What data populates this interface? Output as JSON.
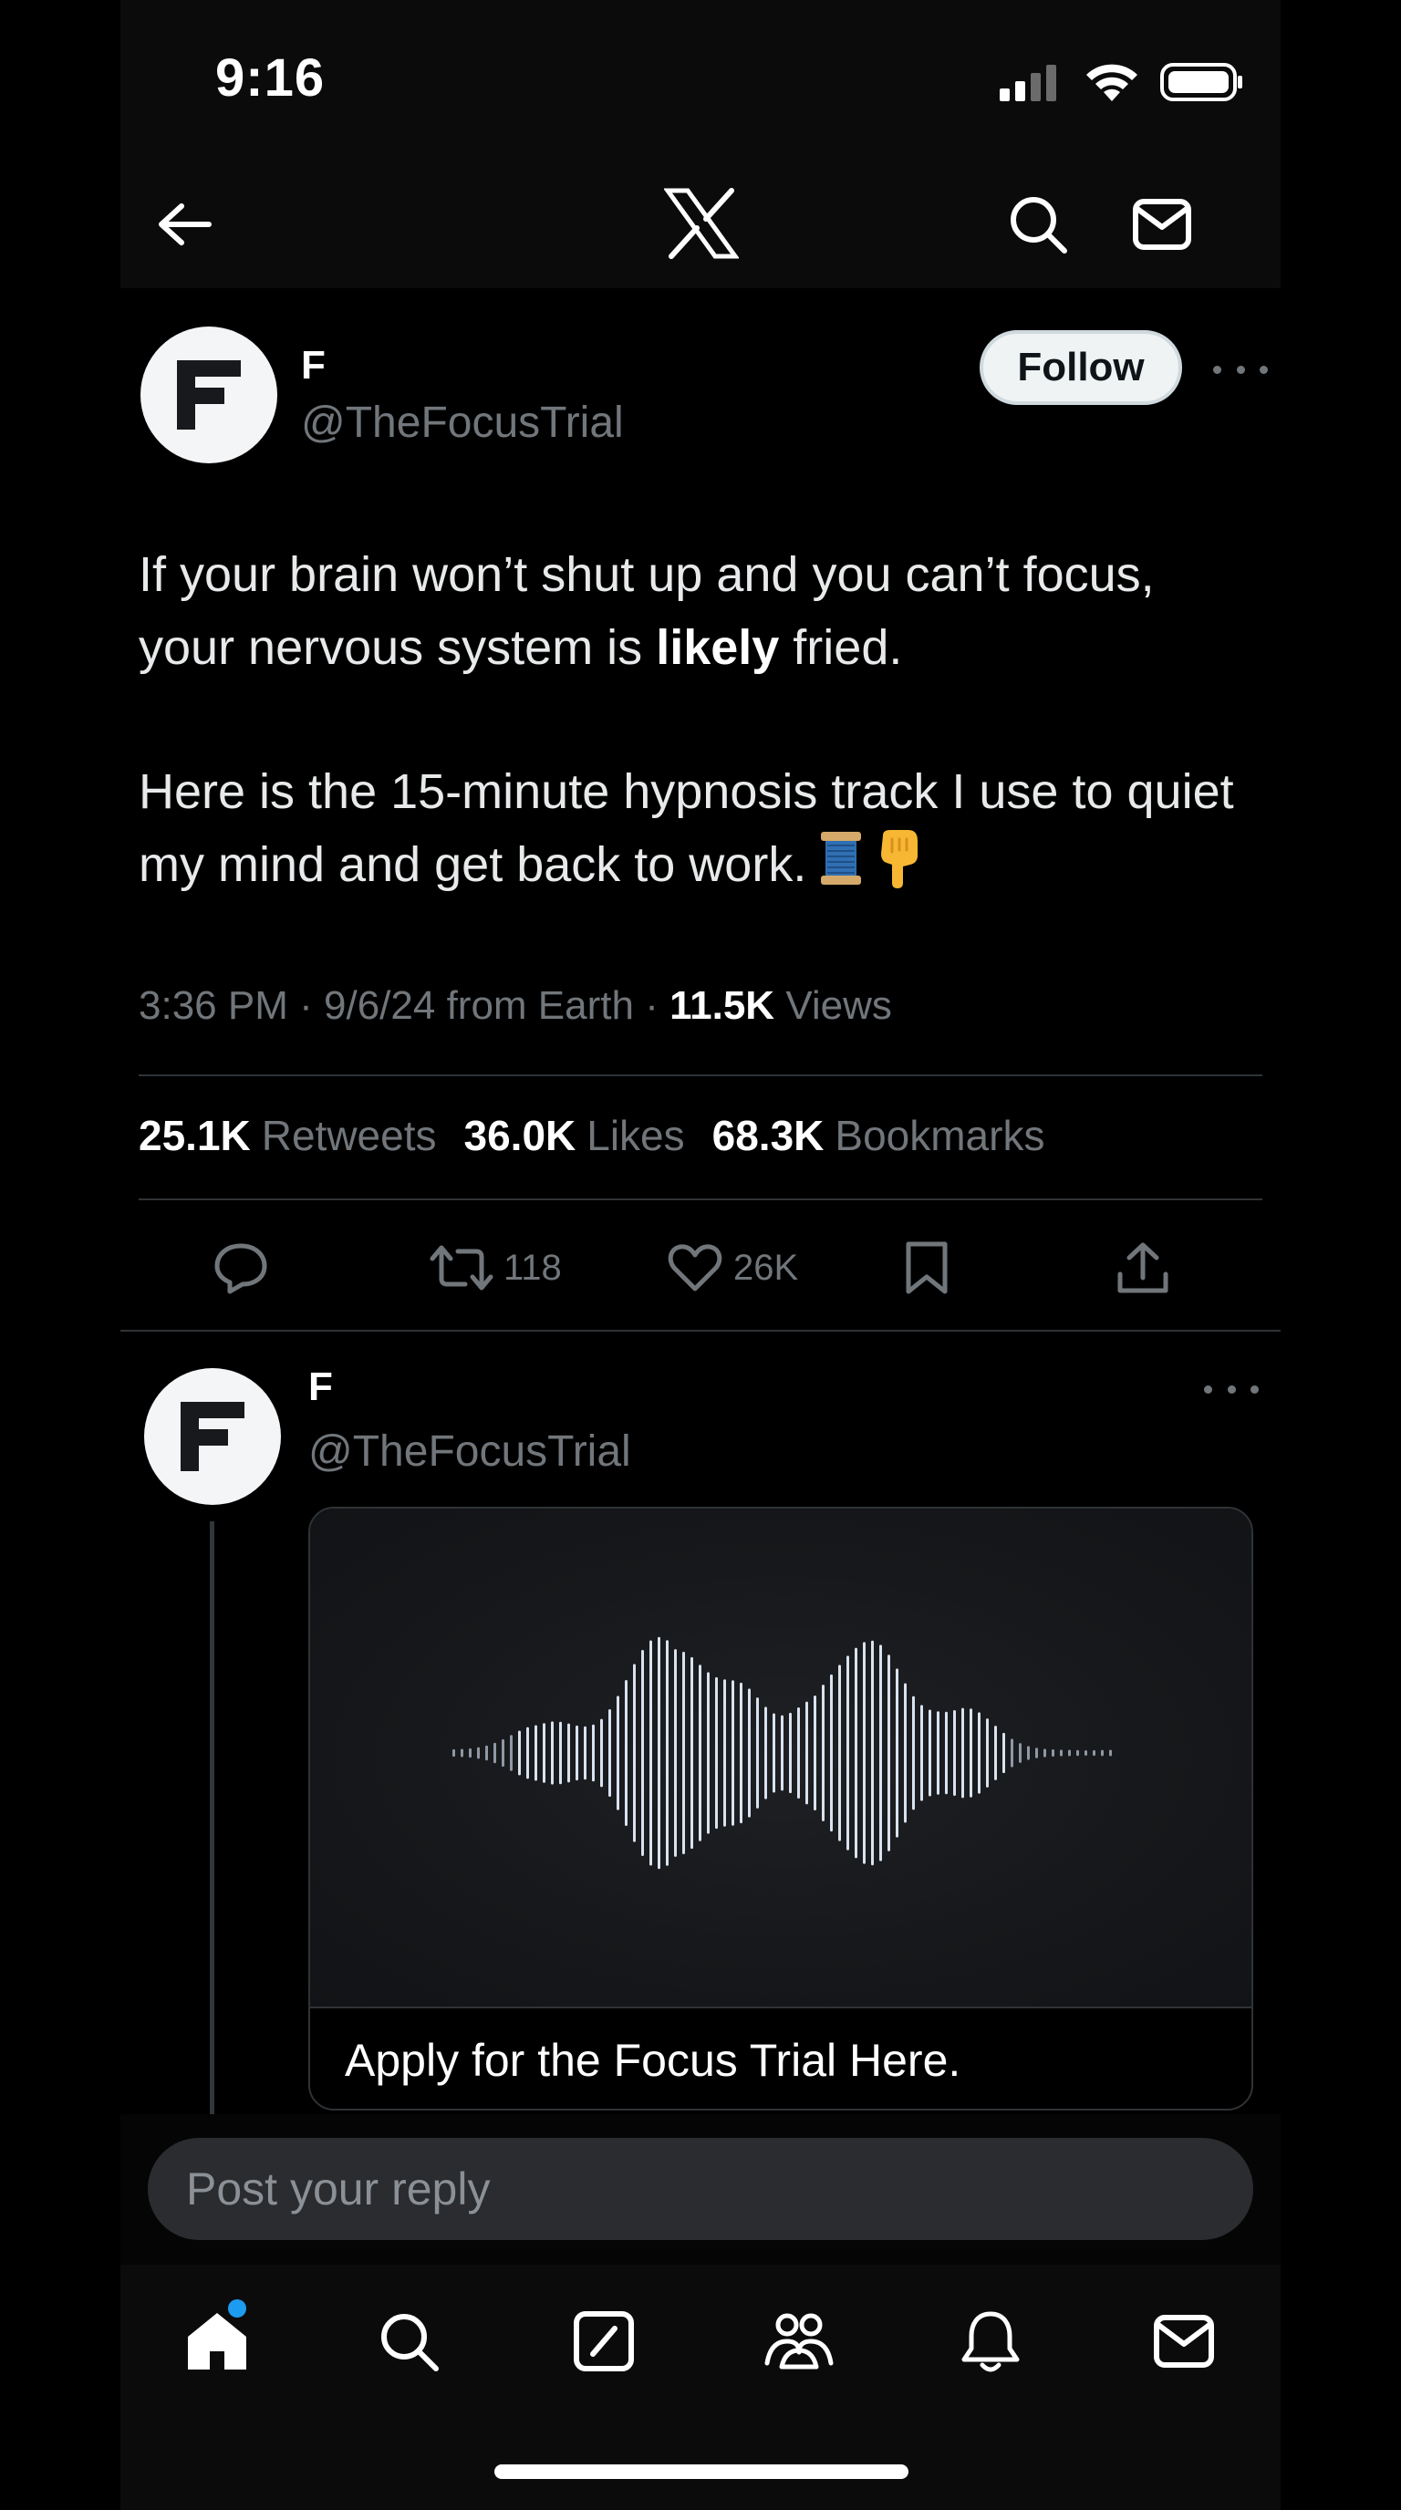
{
  "status_bar": {
    "time": "9:16"
  },
  "app_bar": {
    "back_icon": "arrow-left-icon",
    "logo_icon": "x-logo-icon",
    "search_icon": "search-icon",
    "messages_icon": "mail-icon"
  },
  "tweet": {
    "author_name": "F",
    "author_handle": "@TheFocusTrial",
    "avatar_letter": "F",
    "follow_label": "Follow",
    "text_line1_a": "If your brain won’t shut up and you can’t focus, your nervous system is ",
    "text_line1_bold": "likely",
    "text_line1_b": " fried.",
    "text_line2": "Here is the 15-minute hypnosis track I use to quiet my mind and get back to work.",
    "emojis": [
      "spool-of-thread-emoji",
      "backhand-index-pointing-down-emoji"
    ],
    "time": "3:36 PM",
    "date": "9/6/24",
    "source": "from Earth",
    "views_count": "11.5K",
    "views_label": "Views",
    "retweets_count": "25.1K",
    "retweets_label": "Retweets",
    "likes_count": "36.0K",
    "likes_label": "Likes",
    "bookmarks_count": "68.3K",
    "bookmarks_label": "Bookmarks"
  },
  "actions": {
    "reply_icon": "reply-icon",
    "retweet_count": "118",
    "like_count": "26K",
    "bookmark_icon": "bookmark-icon",
    "share_icon": "share-icon"
  },
  "reply_tweet": {
    "author_name": "F",
    "author_handle": "@TheFocusTrial",
    "media_caption": "Apply for the Focus Trial Here."
  },
  "composer": {
    "placeholder": "Post your reply"
  },
  "tab_bar": {
    "items": [
      "home-icon",
      "search-icon",
      "compose-icon",
      "communities-icon",
      "notifications-icon",
      "messages-icon"
    ]
  },
  "colors": {
    "background": "#000000",
    "text_primary": "#e7e9ea",
    "text_secondary": "#71767b",
    "divider": "#2f3336",
    "accent": "#1d9bf0"
  }
}
